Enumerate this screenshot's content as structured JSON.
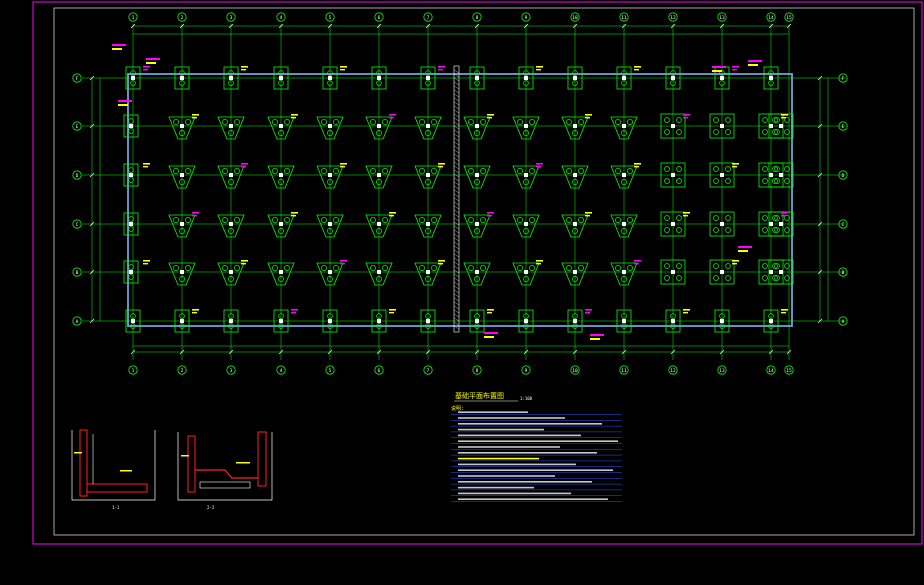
{
  "drawing": {
    "sheet": {
      "title": "基础平面布置图",
      "scale": "1:100"
    },
    "grid": {
      "columns": [
        "1",
        "2",
        "3",
        "4",
        "5",
        "6",
        "7",
        "8",
        "9",
        "10",
        "11",
        "12",
        "13",
        "14",
        "15"
      ],
      "rows": [
        "F",
        "E",
        "D",
        "C",
        "B",
        "A"
      ]
    },
    "notes": {
      "heading": "说明:",
      "line_count": 16
    },
    "details": {
      "left_caption": "1-1",
      "right_caption": "2-2"
    },
    "colors": {
      "background": "#000000",
      "frame": "#ff00ff",
      "inner_frame": "#ffffff",
      "grid_axis": "#00ff00",
      "footing": "#00ff00",
      "beam": "#7fbfff",
      "annotation": "#ffff00",
      "tag": "#ff00ff",
      "detail_red": "#ff2020",
      "notes_rule": "#3050ff"
    }
  }
}
